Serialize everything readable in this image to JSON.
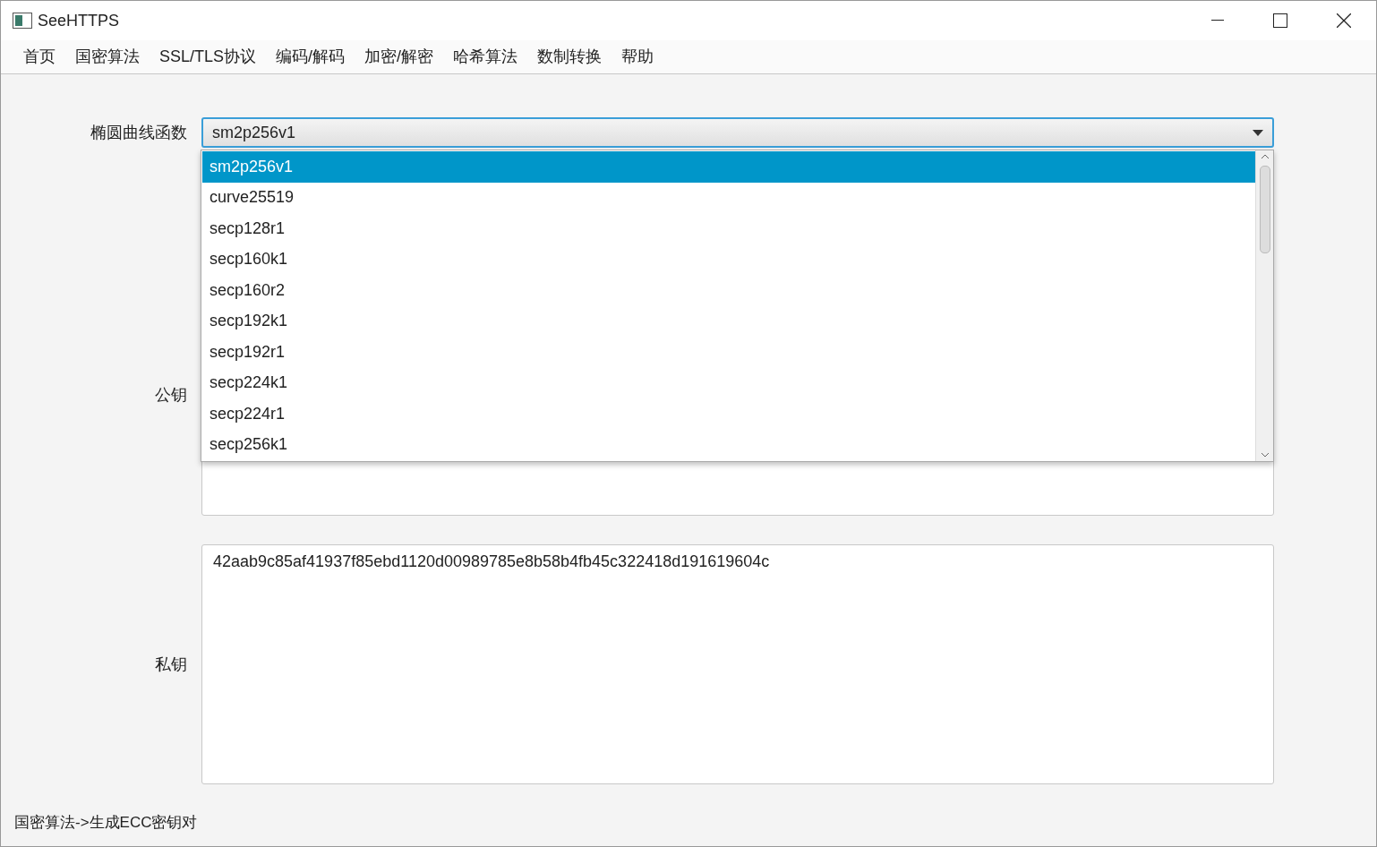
{
  "window": {
    "title": "SeeHTTPS"
  },
  "menu": [
    "首页",
    "国密算法",
    "SSL/TLS协议",
    "编码/解码",
    "加密/解密",
    "哈希算法",
    "数制转换",
    "帮助"
  ],
  "curve": {
    "label": "椭圆曲线函数",
    "value": "sm2p256v1",
    "expanded": true,
    "options": [
      {
        "label": "sm2p256v1",
        "selected": true
      },
      {
        "label": "curve25519",
        "selected": false
      },
      {
        "label": "secp128r1",
        "selected": false
      },
      {
        "label": "secp160k1",
        "selected": false
      },
      {
        "label": "secp160r2",
        "selected": false
      },
      {
        "label": "secp192k1",
        "selected": false
      },
      {
        "label": "secp192r1",
        "selected": false
      },
      {
        "label": "secp224k1",
        "selected": false
      },
      {
        "label": "secp224r1",
        "selected": false
      },
      {
        "label": "secp256k1",
        "selected": false
      }
    ]
  },
  "public_key": {
    "label": "公钥"
  },
  "private_key": {
    "label": "私钥",
    "value": "42aab9c85af41937f85ebd1120d00989785e8b58b4fb45c322418d191619604c"
  },
  "status_bar": "国密算法->生成ECC密钥对"
}
